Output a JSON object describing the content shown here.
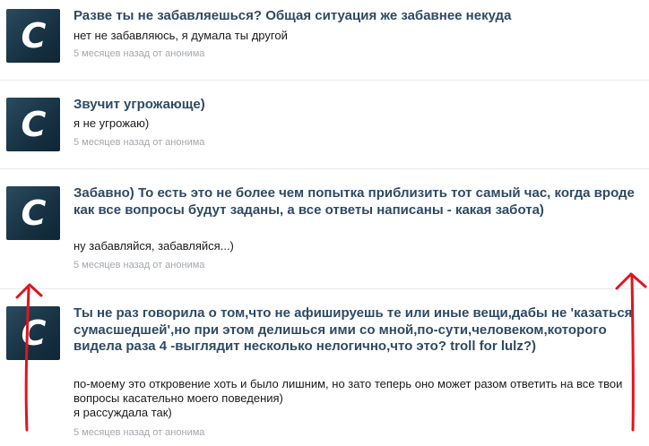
{
  "items": [
    {
      "avatar_letter": "C",
      "question": "Разве ты не забавляешься? Общая ситуация же забавнее некуда",
      "answer": "нет не забавляюсь, я думала ты другой",
      "meta": "5 месяцев назад от анонима"
    },
    {
      "avatar_letter": "C",
      "question": "Звучит угрожающе)",
      "answer": "я не угрожаю)",
      "meta": "5 месяцев назад от анонима"
    },
    {
      "avatar_letter": "C",
      "question": "Забавно) То есть это не более чем попытка приблизить тот самый час, когда вроде как все вопросы будут заданы, а все ответы написаны - какая забота)",
      "answer": "ну забавляйся, забавляйся...)",
      "meta": "5 месяцев назад от анонима"
    },
    {
      "avatar_letter": "C",
      "question": "Ты не раз говорила о том,что не афишируешь те или иные вещи,дабы не 'казаться сумасшедшей',но при этом делишься ими со мной,по-сути,человеком,которого видела раза 4 -выглядит несколько нелогично,что это? troll for lulz?)",
      "answer": "по-моему это откровение хоть и было лишним, но зато теперь оно может разом ответить на все твои вопросы касательно моего поведения)\nя рассуждала так)",
      "meta": "5 месяцев назад от анонима"
    }
  ],
  "annotations": {
    "arrow_color": "#e0141e"
  }
}
